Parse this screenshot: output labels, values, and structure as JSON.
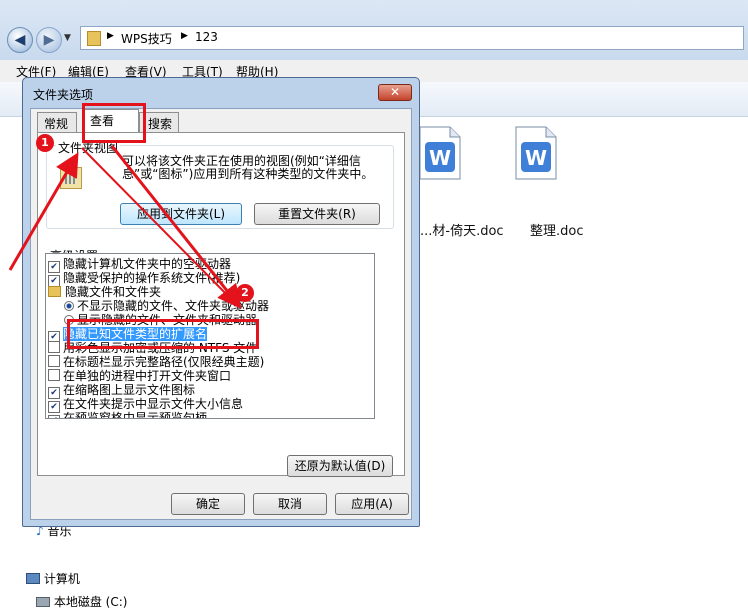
{
  "breadcrumb": [
    "WPS技巧",
    "123"
  ],
  "menubar": [
    "文件(F)",
    "编辑(E)",
    "查看(V)",
    "工具(T)",
    "帮助(H)"
  ],
  "files": [
    {
      "name": "...材-倚天.doc",
      "icon": "wps-doc-icon"
    },
    {
      "name": "整理.doc",
      "icon": "wps-doc-icon"
    }
  ],
  "nav_tree": [
    {
      "label": "音乐",
      "icon": "music-icon"
    },
    {
      "label": "计算机",
      "icon": "computer-icon"
    },
    {
      "label": "本地磁盘 (C:)",
      "icon": "drive-icon"
    }
  ],
  "dialog": {
    "title": "文件夹选项",
    "close_symbol": "✕",
    "tabs": [
      "常规",
      "查看",
      "搜索"
    ],
    "folder_view": {
      "title": "文件夹视图",
      "description": "可以将该文件夹正在使用的视图(例如“详细信息”或“图标”)应用到所有这种类型的文件夹中。",
      "apply_button": "应用到文件夹(L)",
      "reset_button": "重置文件夹(R)"
    },
    "advanced_label": "高级设置:",
    "advanced_items": [
      {
        "type": "checkbox",
        "checked": true,
        "label": "隐藏计算机文件夹中的空驱动器"
      },
      {
        "type": "checkbox",
        "checked": true,
        "label": "隐藏受保护的操作系统文件(推荐)"
      },
      {
        "type": "folder",
        "label": "隐藏文件和文件夹"
      },
      {
        "type": "radio",
        "checked": true,
        "label": "不显示隐藏的文件、文件夹或驱动器"
      },
      {
        "type": "radio",
        "checked": false,
        "label": "显示隐藏的文件、文件夹和驱动器"
      },
      {
        "type": "checkbox",
        "checked": true,
        "selected": true,
        "label": "隐藏已知文件类型的扩展名"
      },
      {
        "type": "checkbox",
        "checked": false,
        "label": "用彩色显示加密或压缩的 NTFS 文件"
      },
      {
        "type": "checkbox",
        "checked": false,
        "label": "在标题栏显示完整路径(仅限经典主题)"
      },
      {
        "type": "checkbox",
        "checked": false,
        "label": "在单独的进程中打开文件夹窗口"
      },
      {
        "type": "checkbox",
        "checked": true,
        "label": "在缩略图上显示文件图标"
      },
      {
        "type": "checkbox",
        "checked": true,
        "label": "在文件夹提示中显示文件大小信息"
      },
      {
        "type": "checkbox",
        "checked": true,
        "label": "在预览窗格中显示预览句柄"
      }
    ],
    "restore_button": "还原为默认值(D)",
    "ok_button": "确定",
    "cancel_button": "取消",
    "apply_button": "应用(A)"
  },
  "annotations": {
    "badge_1": "1",
    "badge_2": "2",
    "color": "#e3121b"
  }
}
